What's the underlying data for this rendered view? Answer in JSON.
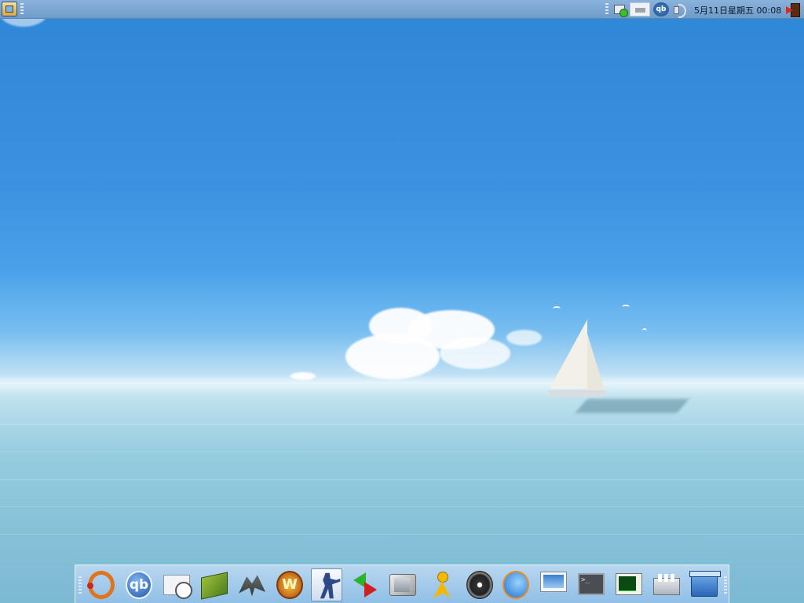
{
  "top_panel": {
    "clock": "5月11日星期五 00:08",
    "tray": [
      {
        "name": "network-icon"
      },
      {
        "name": "printer-icon"
      },
      {
        "name": "qbittorrent-icon",
        "label": "qb"
      },
      {
        "name": "volume-icon"
      }
    ]
  },
  "dock": {
    "launchers": [
      {
        "name": "ubuntu-icon"
      },
      {
        "name": "qbittorrent-icon",
        "label": "qb"
      },
      {
        "name": "mail-clock-icon"
      },
      {
        "name": "book-icon"
      },
      {
        "name": "spaceship-icon"
      },
      {
        "name": "warcraft-icon",
        "label": "W"
      },
      {
        "name": "counter-strike-icon",
        "active": true
      },
      {
        "name": "sync-arrows-icon"
      },
      {
        "name": "tv-icon"
      },
      {
        "name": "messenger-icon"
      },
      {
        "name": "music-disc-icon"
      },
      {
        "name": "browser-globe-icon"
      },
      {
        "name": "display-settings-icon"
      },
      {
        "name": "terminal-icon",
        "label": ">_"
      },
      {
        "name": "system-monitor-icon"
      },
      {
        "name": "mixer-icon"
      },
      {
        "name": "trash-icon"
      }
    ]
  },
  "colors": {
    "panel": "#7aa6d3",
    "dock": "#a6ccec",
    "sky": "#3a92e0",
    "sea": "#86c1d8"
  }
}
